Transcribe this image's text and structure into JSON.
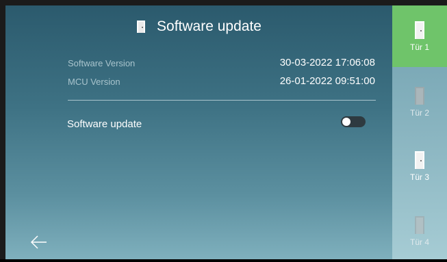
{
  "header": {
    "title": "Software update",
    "icon": "door-icon"
  },
  "info": {
    "software_version_label": "Software Version",
    "software_version_value": "30-03-2022 17:06:08",
    "mcu_version_label": "MCU Version",
    "mcu_version_value": "26-01-2022 09:51:00"
  },
  "settings": {
    "software_update_label": "Software update",
    "software_update_enabled": false
  },
  "sidebar": {
    "items": [
      {
        "label": "Tür 1",
        "active": true
      },
      {
        "label": "Tür 2",
        "active": false
      },
      {
        "label": "Tür 3",
        "active": false
      },
      {
        "label": "Tür 4",
        "active": false
      }
    ]
  },
  "colors": {
    "active_green": "#6fc46a",
    "toggle_off": "#2e3a40"
  }
}
